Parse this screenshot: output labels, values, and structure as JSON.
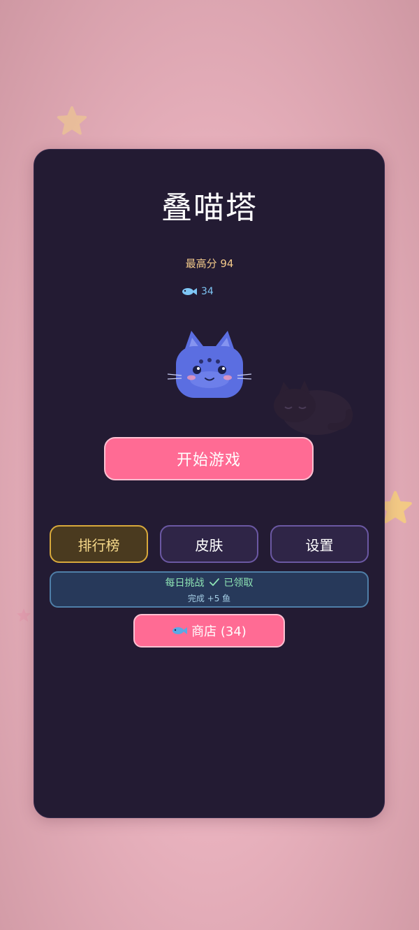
{
  "app": {
    "title": "叠喵塔"
  },
  "stats": {
    "best_score_label": "最高分 94",
    "fish_count": "34"
  },
  "icons": {
    "fish": "fish-icon",
    "check": "check-icon",
    "star": "star-icon",
    "cat": "blue-cat-face",
    "sleeping_cat": "sleeping-black-cat"
  },
  "buttons": {
    "start": "开始游戏",
    "leaderboard": "排行榜",
    "skins": "皮肤",
    "settings": "设置",
    "shop": "商店 (34)"
  },
  "daily_challenge": {
    "title": "每日挑战",
    "status": "已领取",
    "reward": "完成 +5 鱼"
  },
  "colors": {
    "background": "#f2bac8",
    "panel": "#231b33",
    "primary_button": "#ff6b94",
    "leaderboard_accent": "#d8a93b",
    "menu_border": "#6b58a3",
    "daily_border": "#4f7fa8",
    "fish_blue": "#7ec6f5",
    "cat_blue": "#5b6ee1"
  }
}
